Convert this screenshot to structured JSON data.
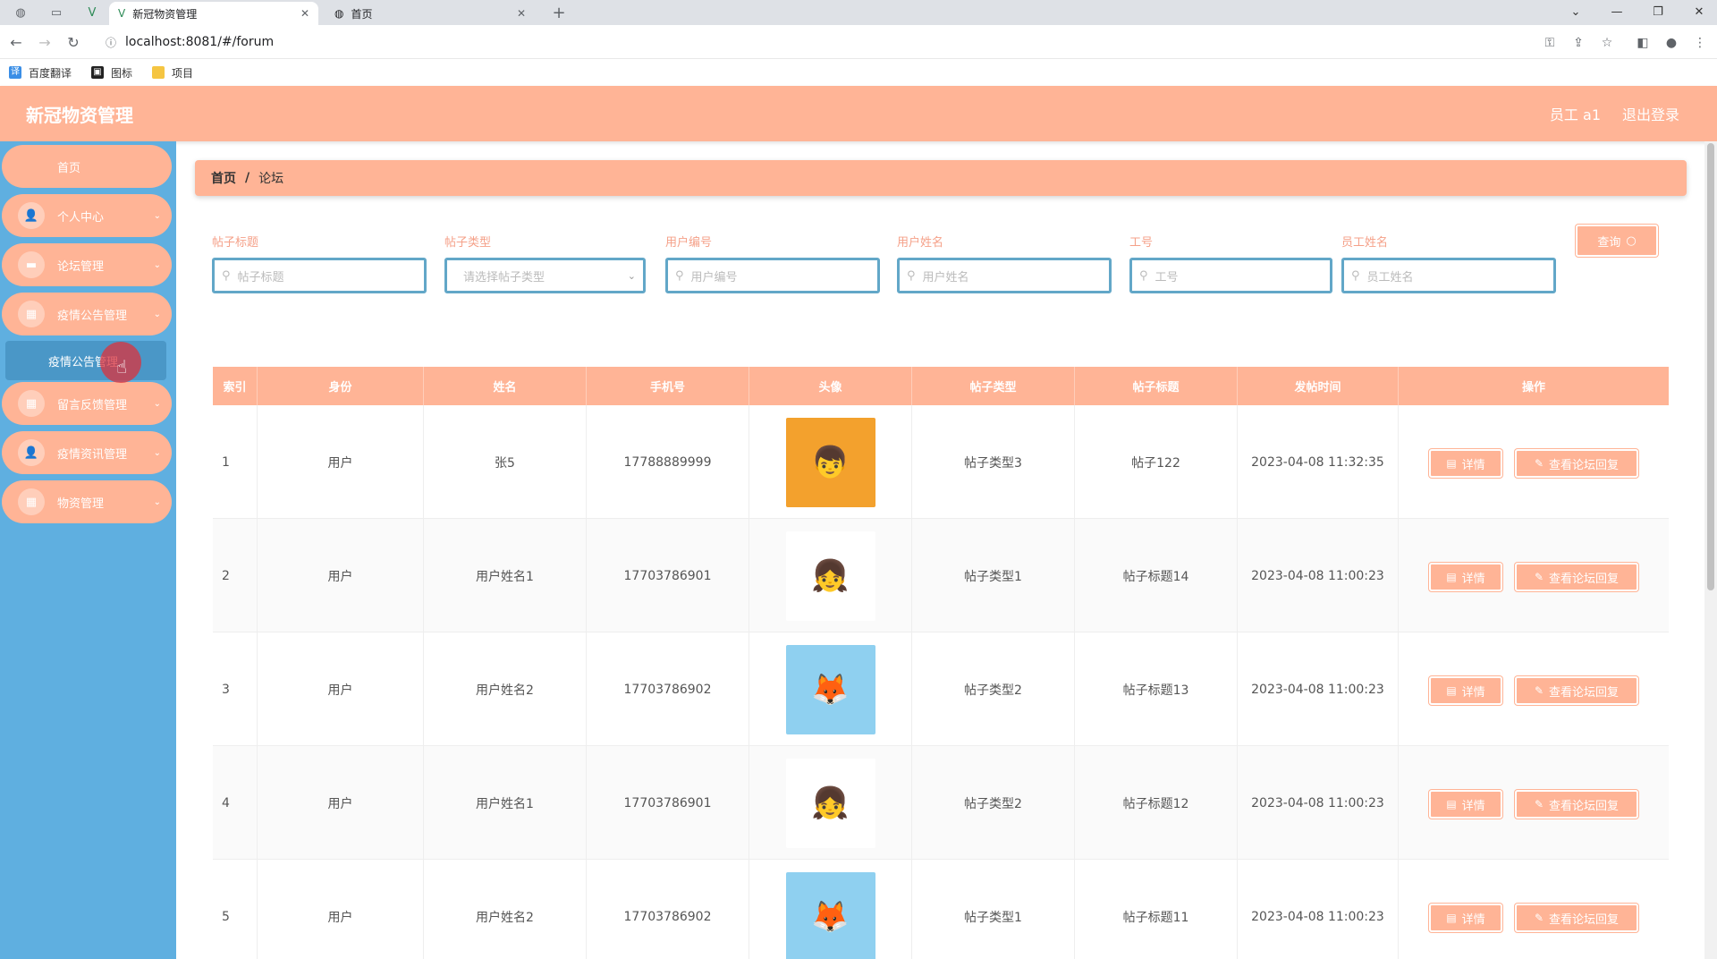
{
  "browser": {
    "tabs": [
      {
        "title": "新冠物资管理",
        "active": true
      },
      {
        "title": "首页",
        "active": false
      }
    ],
    "url": "localhost:8081/#/forum",
    "bookmarks": [
      {
        "label": "百度翻译"
      },
      {
        "label": "图标"
      },
      {
        "label": "项目"
      }
    ]
  },
  "header": {
    "title": "新冠物资管理",
    "user": "员工 a1",
    "logout": "退出登录"
  },
  "sidebar": {
    "home": "首页",
    "items": [
      {
        "label": "个人中心",
        "icon": "user-icon"
      },
      {
        "label": "论坛管理",
        "icon": "briefcase-icon"
      },
      {
        "label": "疫情公告管理",
        "icon": "grid-icon"
      },
      {
        "label": "留言反馈管理",
        "icon": "grid-icon"
      },
      {
        "label": "疫情资讯管理",
        "icon": "user-icon"
      },
      {
        "label": "物资管理",
        "icon": "grid-icon"
      }
    ],
    "sub_item": "疫情公告管理"
  },
  "breadcrumb": {
    "home": "首页",
    "separator": "/",
    "current": "论坛"
  },
  "filters": [
    {
      "label": "帖子标题",
      "placeholder": "帖子标题"
    },
    {
      "label": "帖子类型",
      "placeholder": "请选择帖子类型"
    },
    {
      "label": "用户编号",
      "placeholder": "用户编号"
    },
    {
      "label": "用户姓名",
      "placeholder": "用户姓名"
    },
    {
      "label": "工号",
      "placeholder": "工号"
    },
    {
      "label": "员工姓名",
      "placeholder": "员工姓名"
    }
  ],
  "query_button": "查询",
  "table": {
    "headers": [
      "索引",
      "身份",
      "姓名",
      "手机号",
      "头像",
      "帖子类型",
      "帖子标题",
      "发帖时间",
      "操作"
    ],
    "rows": [
      {
        "index": "1",
        "role": "用户",
        "name": "张5",
        "phone": "17788889999",
        "avatar": "boy-cartoon-avatar",
        "type": "帖子类型3",
        "title": "帖子122",
        "time": "2023-04-08 11:32:35"
      },
      {
        "index": "2",
        "role": "用户",
        "name": "用户姓名1",
        "phone": "17703786901",
        "avatar": "girl-cartoon-avatar",
        "type": "帖子类型1",
        "title": "帖子标题14",
        "time": "2023-04-08 11:00:23"
      },
      {
        "index": "3",
        "role": "用户",
        "name": "用户姓名2",
        "phone": "17703786902",
        "avatar": "fox-cartoon-avatar",
        "type": "帖子类型2",
        "title": "帖子标题13",
        "time": "2023-04-08 11:00:23"
      },
      {
        "index": "4",
        "role": "用户",
        "name": "用户姓名1",
        "phone": "17703786901",
        "avatar": "girl-cartoon-avatar",
        "type": "帖子类型2",
        "title": "帖子标题12",
        "time": "2023-04-08 11:00:23"
      },
      {
        "index": "5",
        "role": "用户",
        "name": "用户姓名2",
        "phone": "17703786902",
        "avatar": "fox-cartoon-avatar",
        "type": "帖子类型1",
        "title": "帖子标题11",
        "time": "2023-04-08 11:00:23"
      }
    ],
    "actions": {
      "detail": "详情",
      "reply": "查看论坛回复"
    }
  },
  "colors": {
    "accent": "#ffb496",
    "sidebar": "#5fafe0",
    "label": "#f5a189",
    "input_border": "#62a7c8"
  }
}
